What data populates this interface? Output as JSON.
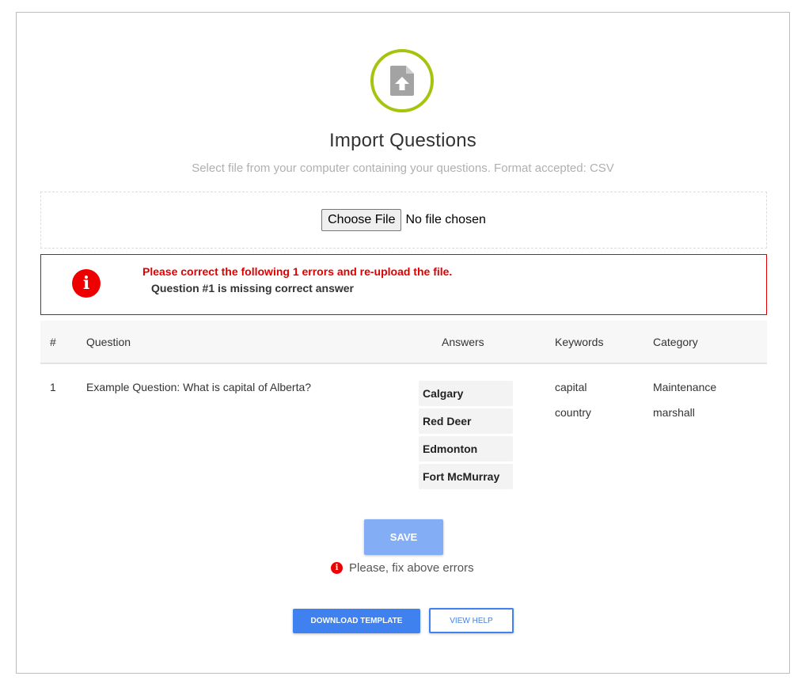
{
  "header": {
    "title": "Import Questions",
    "subtitle": "Select file from your computer containing your questions. Format accepted: CSV",
    "icon": "file-upload-icon"
  },
  "file_input": {
    "button_label": "Choose File",
    "status": "No file chosen"
  },
  "error_box": {
    "icon": "info-icon",
    "headline": "Please correct the following 1 errors and re-upload the file.",
    "detail": "Question #1 is missing correct answer"
  },
  "table": {
    "columns": [
      "#",
      "Question",
      "Answers",
      "Keywords",
      "Category"
    ],
    "rows": [
      {
        "number": "1",
        "question": "Example Question: What is capital of Alberta?",
        "answers": [
          "Calgary",
          "Red Deer",
          "Edmonton",
          "Fort McMurray"
        ],
        "keywords": [
          "capital",
          "country"
        ],
        "categories": [
          "Maintenance",
          "marshall"
        ]
      }
    ]
  },
  "actions": {
    "save_label": "SAVE",
    "fix_message": "Please, fix above errors",
    "download_label": "DOWNLOAD TEMPLATE",
    "help_label": "VIEW HELP"
  },
  "colors": {
    "accent": "#a6c40e",
    "error": "#ee0000",
    "primary": "#3f81ee",
    "primary_disabled": "#83aef6"
  }
}
